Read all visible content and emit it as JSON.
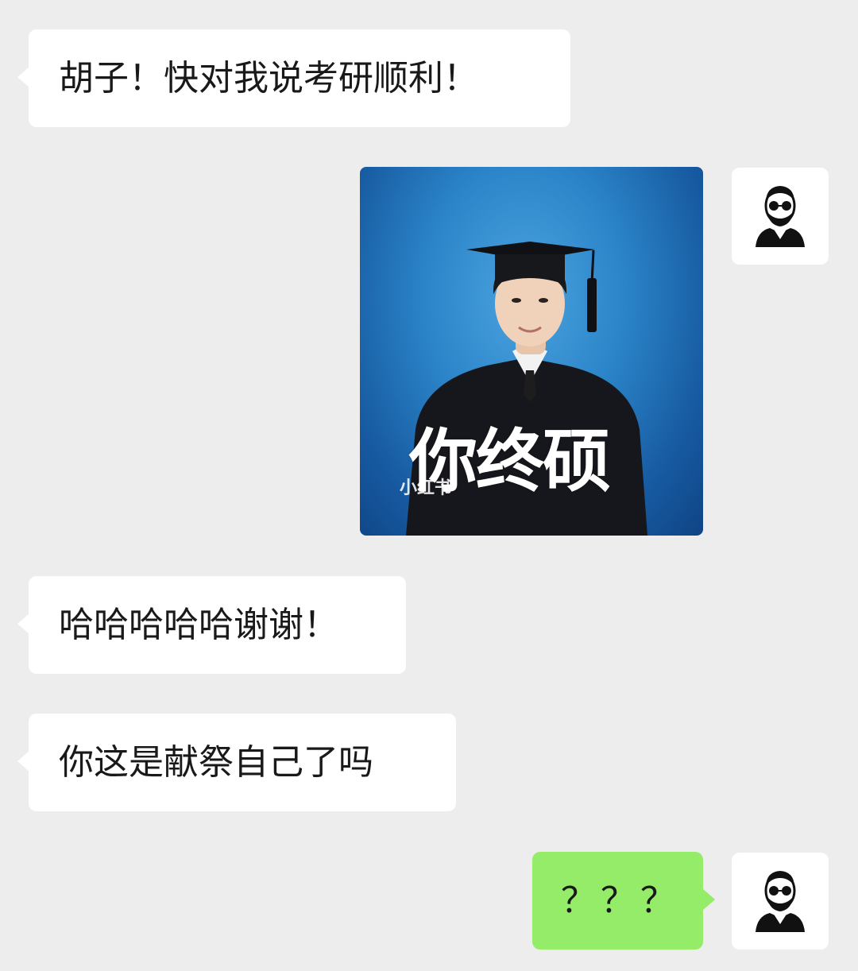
{
  "messages": [
    {
      "side": "incoming",
      "type": "text",
      "text": "胡子！快对我说考研顺利！"
    },
    {
      "side": "outgoing",
      "type": "image",
      "caption": "你终硕",
      "watermark": "小红书"
    },
    {
      "side": "incoming",
      "type": "text",
      "text": "哈哈哈哈哈谢谢！"
    },
    {
      "side": "incoming",
      "type": "text",
      "text": "你这是献祭自己了吗"
    },
    {
      "side": "outgoing",
      "type": "text",
      "text": "？？？"
    }
  ],
  "avatar_icon": "bearded-man-sunglasses-icon",
  "colors": {
    "background": "#ededed",
    "incoming_bubble": "#ffffff",
    "outgoing_bubble": "#95ec69",
    "text": "#191919"
  }
}
